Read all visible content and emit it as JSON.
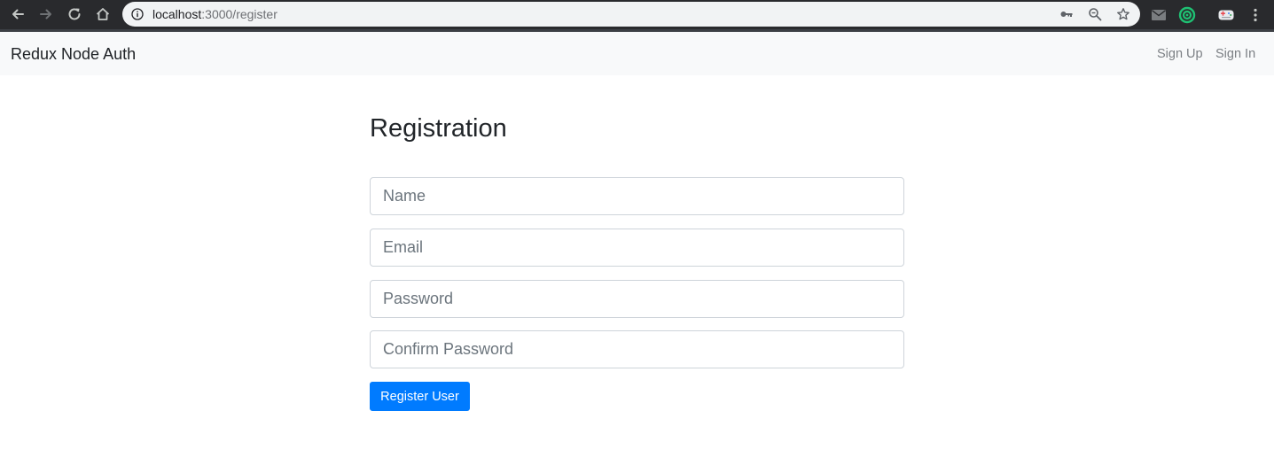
{
  "browser": {
    "url_host": "localhost",
    "url_path": ":3000/register",
    "icons": {
      "back": "back-arrow-icon",
      "forward": "forward-arrow-icon",
      "reload": "reload-icon",
      "home": "home-icon",
      "site_info": "info-icon",
      "passwords": "key-icon",
      "zoom": "zoom-icon",
      "bookmark": "star-icon",
      "mail_extension": "mail-icon",
      "target_extension": "target-icon",
      "gamepad_extension": "gamepad-icon",
      "menu": "more-vertical-icon"
    }
  },
  "navbar": {
    "brand": "Redux Node Auth",
    "links": [
      "Sign Up",
      "Sign In"
    ],
    "background": "#f8f9fa"
  },
  "form": {
    "title": "Registration",
    "fields": [
      {
        "placeholder": "Name",
        "value": ""
      },
      {
        "placeholder": "Email",
        "value": ""
      },
      {
        "placeholder": "Password",
        "value": ""
      },
      {
        "placeholder": "Confirm Password",
        "value": ""
      }
    ],
    "submit_label": "Register User",
    "accent_color": "#007bff"
  }
}
